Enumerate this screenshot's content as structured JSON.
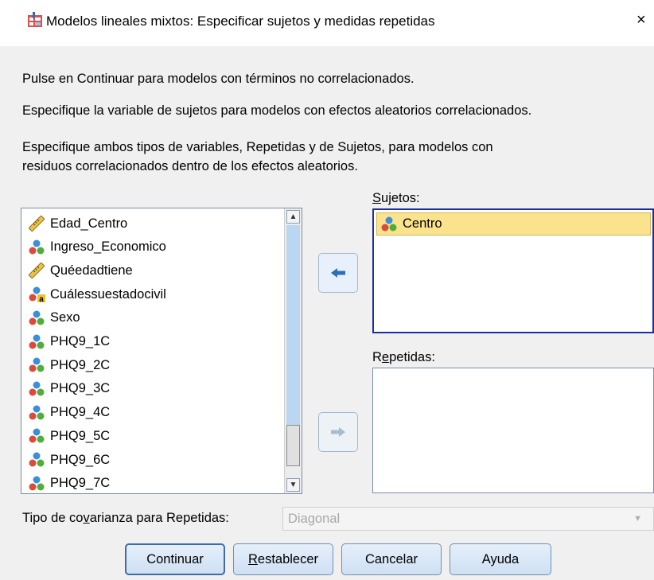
{
  "window": {
    "title": "Modelos lineales mixtos: Especificar sujetos y medidas repetidas",
    "close": "×"
  },
  "instructions": {
    "line1": "Pulse en Continuar para modelos con términos no correlacionados.",
    "line2": "Especifique la variable de sujetos para modelos con efectos aleatorios correlacionados.",
    "line3a": "Especifique ambos tipos de variables, Repetidas y de Sujetos, para modelos con",
    "line3b": "residuos correlacionados dentro de los efectos aleatorios."
  },
  "variables": [
    {
      "name": "Edad_Centro",
      "type": "scale"
    },
    {
      "name": "Ingreso_Economico",
      "type": "nominal"
    },
    {
      "name": "Quéedadtiene",
      "type": "scale"
    },
    {
      "name": "Cuálessuestadocivil",
      "type": "nominal-string"
    },
    {
      "name": "Sexo",
      "type": "nominal"
    },
    {
      "name": "PHQ9_1C",
      "type": "nominal"
    },
    {
      "name": "PHQ9_2C",
      "type": "nominal"
    },
    {
      "name": "PHQ9_3C",
      "type": "nominal"
    },
    {
      "name": "PHQ9_4C",
      "type": "nominal"
    },
    {
      "name": "PHQ9_5C",
      "type": "nominal"
    },
    {
      "name": "PHQ9_6C",
      "type": "nominal"
    },
    {
      "name": "PHQ9_7C",
      "type": "nominal"
    }
  ],
  "sujetos": {
    "label_prefix": "",
    "label_underline": "S",
    "label_rest": "ujetos:",
    "items": [
      {
        "name": "Centro",
        "type": "nominal"
      }
    ]
  },
  "repetidas": {
    "label_prefix": "R",
    "label_underline": "e",
    "label_rest": "petidas:",
    "items": []
  },
  "covariance": {
    "label_prefix": "Tipo de co",
    "label_underline": "v",
    "label_rest": "arianza para Repetidas:",
    "value": "Diagonal",
    "enabled": false
  },
  "buttons": {
    "continuar": "Continuar",
    "restablecer_u": "R",
    "restablecer_rest": "establecer",
    "cancelar": "Cancelar",
    "ayuda": "Ayuda"
  },
  "colors": {
    "dialog_bg": "#f0f0f0",
    "selected_item": "#fbe38d",
    "box_border_active": "#1d2fa0",
    "arrow_active": "#2d6db5",
    "arrow_disabled": "#a8bcd0"
  }
}
